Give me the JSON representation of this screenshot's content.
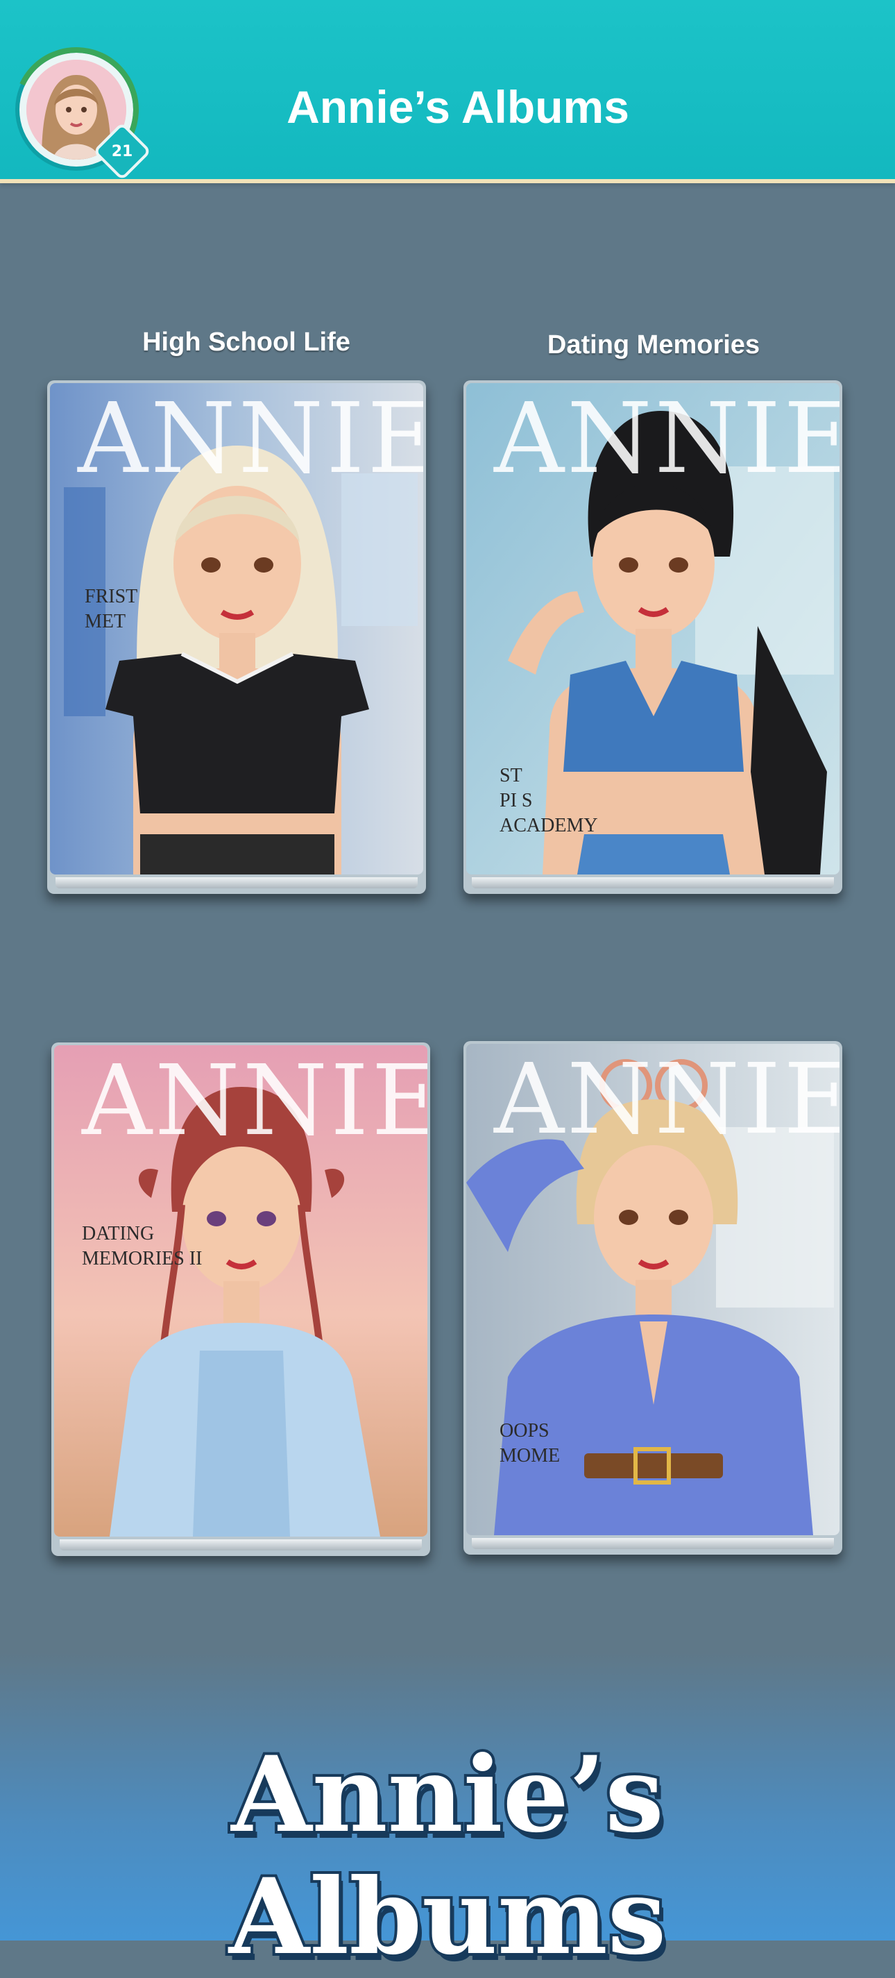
{
  "header": {
    "title": "Annie’s Albums",
    "level": "21"
  },
  "albums": [
    {
      "label": "High School Life",
      "cover_title": "ANNIE",
      "cover_text": "FRIST\nMET",
      "hair": "#efe6cf",
      "top": "#1f1f22",
      "bg": "#8fb1d8"
    },
    {
      "label": "Dating Memories",
      "cover_title": "ANNIE",
      "cover_text": "ST\nPI   S\nACADEMY",
      "hair": "#1a1a1c",
      "top": "#3f79bd",
      "bg": "#9dc7d9"
    },
    {
      "label": "",
      "cover_title": "ANNIE",
      "cover_text": "DATING\nMEMORIES II",
      "hair": "#a6423c",
      "top": "#b9d6ee",
      "bg": "#e8a9b7"
    },
    {
      "label": "",
      "cover_title": "ANNIE",
      "cover_text": "OOPS\nMOME",
      "hair": "#e7c897",
      "top": "#6b82d8",
      "bg": "#bcc9d3"
    }
  ],
  "banner": {
    "title": "Annie’s Albums"
  },
  "colors": {
    "header": "#13b8bf",
    "background": "#5f7888",
    "banner_blue": "#4596d6"
  }
}
